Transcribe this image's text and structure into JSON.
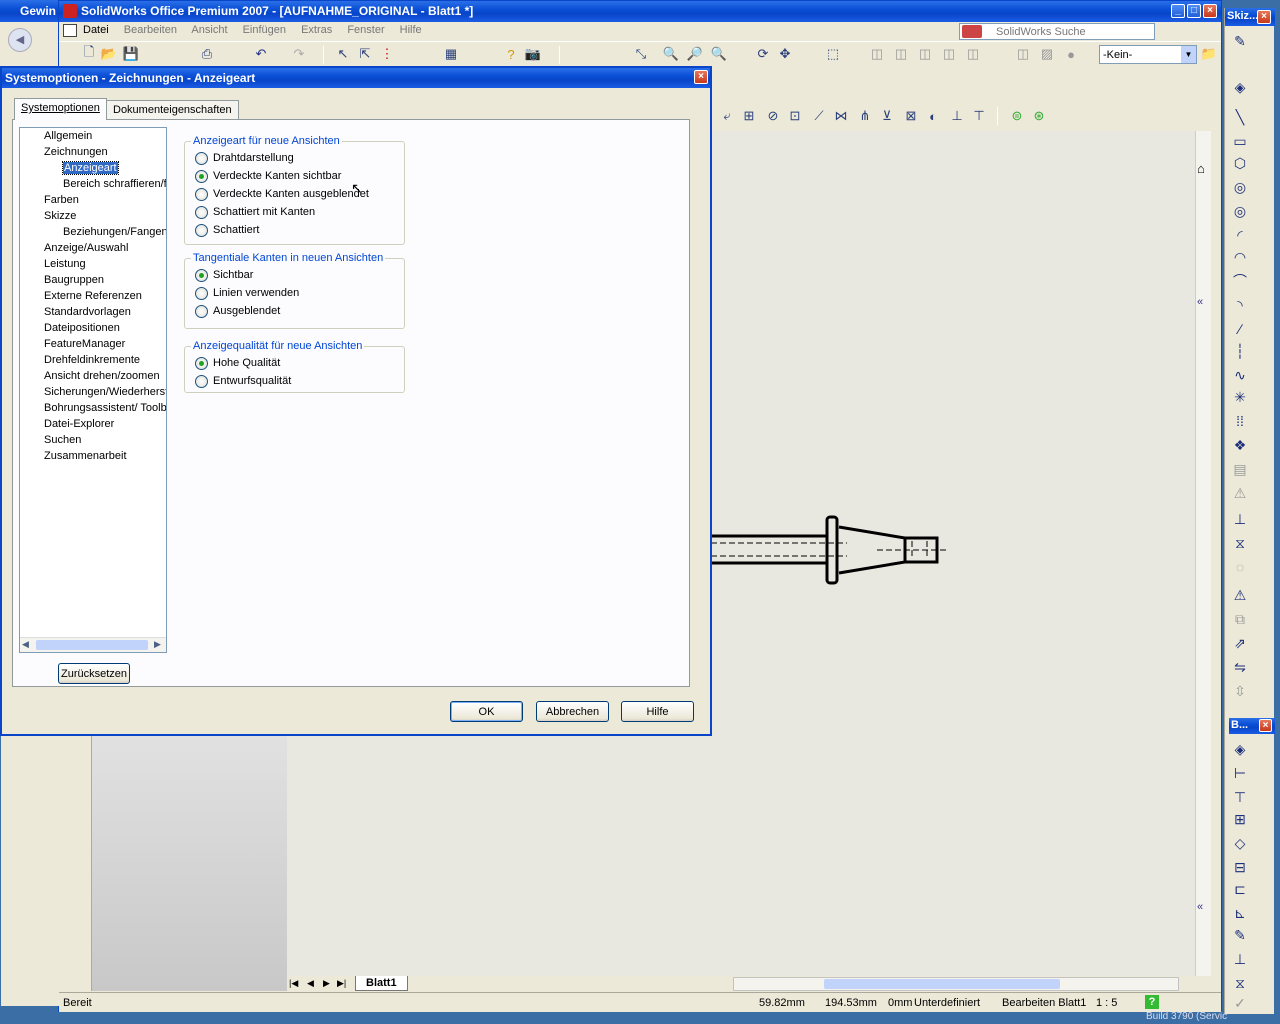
{
  "app": {
    "title": "SolidWorks Office Premium 2007 - [AUFNAHME_ORIGINAL - Blatt1 *]",
    "left_window_fragment": "Gewin",
    "menu": [
      "Datei",
      "Bearbeiten",
      "Ansicht",
      "Einfügen",
      "Extras",
      "Fenster",
      "Hilfe"
    ],
    "search_label": "SolidWorks Suche",
    "config_select": "-Kein-",
    "right_panel_title": "Skiz...",
    "right_panel2_title": "B...",
    "sheet_tab": "Blatt1",
    "build_text": "Build 3790 (Servic"
  },
  "status": {
    "ready": "Bereit",
    "x": "59.82mm",
    "y": "194.53mm",
    "z": "0mm",
    "state": "Unterdefiniert",
    "edit": "Bearbeiten Blatt1",
    "scale": "1 : 5"
  },
  "dialog": {
    "title": "Systemoptionen - Zeichnungen - Anzeigeart",
    "tabs": [
      "Systemoptionen",
      "Dokumenteigenschaften"
    ],
    "tree": [
      {
        "label": "Allgemein",
        "level": 0
      },
      {
        "label": "Zeichnungen",
        "level": 0
      },
      {
        "label": "Anzeigeart",
        "level": 1,
        "selected": true
      },
      {
        "label": "Bereich schraffieren/f",
        "level": 1
      },
      {
        "label": "Farben",
        "level": 0
      },
      {
        "label": "Skizze",
        "level": 0
      },
      {
        "label": "Beziehungen/Fangen",
        "level": 1
      },
      {
        "label": "Anzeige/Auswahl",
        "level": 0
      },
      {
        "label": "Leistung",
        "level": 0
      },
      {
        "label": "Baugruppen",
        "level": 0
      },
      {
        "label": "Externe Referenzen",
        "level": 0
      },
      {
        "label": "Standardvorlagen",
        "level": 0
      },
      {
        "label": "Dateipositionen",
        "level": 0
      },
      {
        "label": "FeatureManager",
        "level": 0
      },
      {
        "label": "Drehfeldinkremente",
        "level": 0
      },
      {
        "label": "Ansicht drehen/zoomen",
        "level": 0
      },
      {
        "label": "Sicherungen/Wiederherst",
        "level": 0
      },
      {
        "label": "Bohrungsassistent/ Toolb",
        "level": 0
      },
      {
        "label": "Datei-Explorer",
        "level": 0
      },
      {
        "label": "Suchen",
        "level": 0
      },
      {
        "label": "Zusammenarbeit",
        "level": 0
      }
    ],
    "groups": {
      "display_mode": {
        "legend": "Anzeigeart für neue Ansichten",
        "options": [
          "Drahtdarstellung",
          "Verdeckte Kanten sichtbar",
          "Verdeckte Kanten ausgeblendet",
          "Schattiert mit Kanten",
          "Schattiert"
        ],
        "selected": "Verdeckte Kanten sichtbar"
      },
      "tangent_edges": {
        "legend": "Tangentiale Kanten in neuen Ansichten",
        "options": [
          "Sichtbar",
          "Linien verwenden",
          "Ausgeblendet"
        ],
        "selected": "Sichtbar"
      },
      "quality": {
        "legend": "Anzeigequalität für neue Ansichten",
        "options": [
          "Hohe Qualität",
          "Entwurfsqualität"
        ],
        "selected": "Hohe Qualität"
      }
    },
    "reset_button": "Zurücksetzen",
    "ok_button": "OK",
    "cancel_button": "Abbrechen",
    "help_button": "Hilfe"
  }
}
